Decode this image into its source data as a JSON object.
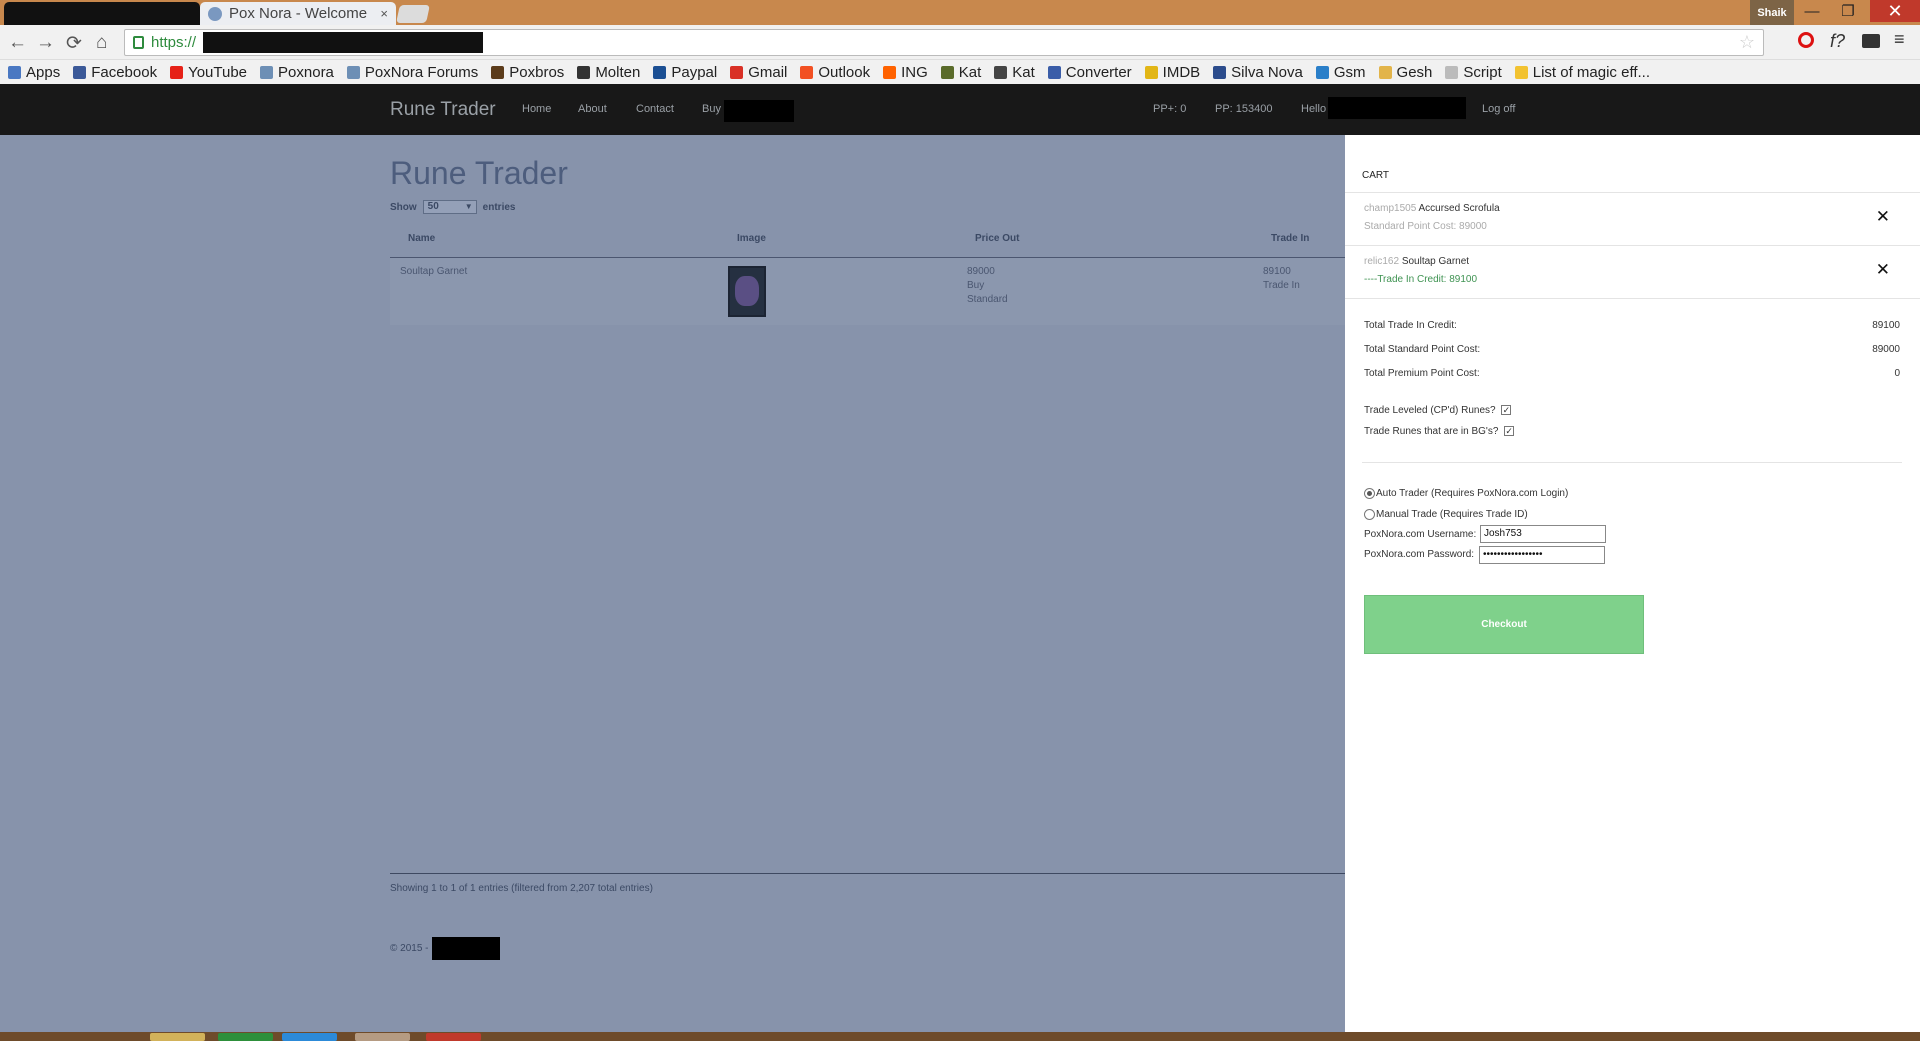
{
  "browser": {
    "tab_title": "Pox Nora - Welcome",
    "tab_close": "×",
    "window_user": "Shaik",
    "window_min": "—",
    "window_max": "❐",
    "window_close": "✕",
    "url_prefix": "https://",
    "back": "←",
    "forward": "→",
    "reload": "⟳",
    "home": "⌂",
    "star": "☆",
    "ext_menu": "≡",
    "ext_f": "f?"
  },
  "bookmarks": [
    {
      "label": "Apps",
      "color": "#4a78c2"
    },
    {
      "label": "Facebook",
      "color": "#3b5998"
    },
    {
      "label": "YouTube",
      "color": "#e62117"
    },
    {
      "label": "Poxnora",
      "color": "#6d8fb5"
    },
    {
      "label": "PoxNora Forums",
      "color": "#6d8fb5"
    },
    {
      "label": "Poxbros",
      "color": "#5b3b1a"
    },
    {
      "label": "Molten",
      "color": "#333333"
    },
    {
      "label": "Paypal",
      "color": "#1b4f93"
    },
    {
      "label": "Gmail",
      "color": "#d93025"
    },
    {
      "label": "Outlook",
      "color": "#f25022"
    },
    {
      "label": "ING",
      "color": "#ff6200"
    },
    {
      "label": "Kat",
      "color": "#5a6b2a"
    },
    {
      "label": "Kat",
      "color": "#444444"
    },
    {
      "label": "Converter",
      "color": "#3a5da8"
    },
    {
      "label": "IMDB",
      "color": "#e2b616"
    },
    {
      "label": "Silva Nova",
      "color": "#2c4c8c"
    },
    {
      "label": "Gsm",
      "color": "#2a7fc9"
    },
    {
      "label": "Gesh",
      "color": "#e2b44a"
    },
    {
      "label": "Script",
      "color": "#bbbbbb"
    },
    {
      "label": "List of magic eff...",
      "color": "#f2c230"
    }
  ],
  "site": {
    "brand": "Rune Trader",
    "nav": {
      "home": "Home",
      "about": "About",
      "contact": "Contact",
      "buy": "Buy"
    },
    "ppplus": "PP+: 0",
    "pp": "PP: 153400",
    "hello": "Hello",
    "logoff": "Log off"
  },
  "main": {
    "title": "Rune Trader",
    "show_label": "Show",
    "entries_value": "50",
    "entries_label": "entries",
    "columns": [
      "Name",
      "Image",
      "Price Out",
      "Trade In"
    ],
    "rows": [
      {
        "name": "Soultap Garnet",
        "price_value": "89000",
        "price_action": "Buy",
        "price_type": "Standard",
        "trade_value": "89100",
        "trade_label": "Trade In"
      }
    ],
    "footer_info": "Showing 1 to 1 of 1 entries (filtered from 2,207 total entries)",
    "copyright": "© 2015 -"
  },
  "cart": {
    "title": "CART",
    "items": [
      {
        "owner": "champ1505",
        "name": "Accursed Scrofula",
        "detail": "Standard Point Cost: 89000"
      },
      {
        "owner": "relic162",
        "name": "Soultap Garnet",
        "detail": "----Trade In Credit: 89100"
      }
    ],
    "remove": "✕",
    "totals": [
      {
        "label": "Total Trade In Credit:",
        "value": "89100"
      },
      {
        "label": "Total Standard Point Cost:",
        "value": "89000"
      },
      {
        "label": "Total Premium Point Cost:",
        "value": "0"
      }
    ],
    "option_leveled": "Trade Leveled (CP'd) Runes?",
    "option_bgs": "Trade Runes that are in BG's?",
    "check": "✓",
    "auto_trader": "Auto Trader (Requires PoxNora.com Login)",
    "manual_trade": "Manual Trade (Requires Trade ID)",
    "username_label": "PoxNora.com Username:",
    "username_value": "Josh753",
    "password_label": "PoxNora.com Password:",
    "password_value": "•••••••••••••••••",
    "checkout": "Checkout"
  }
}
